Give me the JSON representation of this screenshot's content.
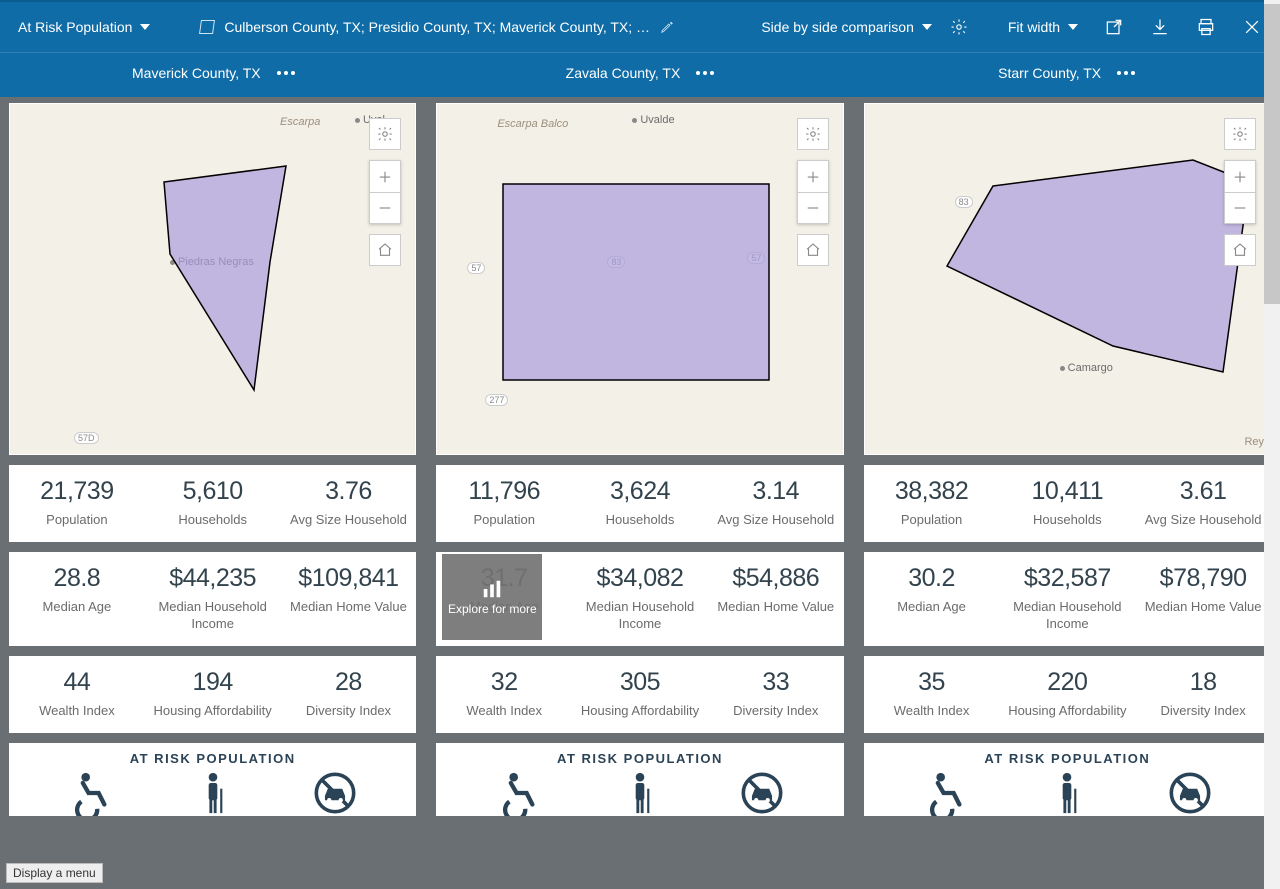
{
  "topbar": {
    "template_name": "At Risk Population",
    "geo_text": "Culberson County, TX; Presidio County, TX; Maverick County, TX; …",
    "view_mode": "Side by side comparison",
    "fit": "Fit width"
  },
  "columns": [
    {
      "title": "Maverick County, TX",
      "map_city": "Piedras Negras",
      "map_road": "57D",
      "map_label": "Escarpa",
      "map_label2": "Uval",
      "stats1": [
        {
          "v": "21,739",
          "l": "Population"
        },
        {
          "v": "5,610",
          "l": "Households"
        },
        {
          "v": "3.76",
          "l": "Avg Size Household"
        }
      ],
      "stats2": [
        {
          "v": "28.8",
          "l": "Median Age"
        },
        {
          "v": "$44,235",
          "l": "Median Household Income"
        },
        {
          "v": "$109,841",
          "l": "Median Home Value"
        }
      ],
      "stats3": [
        {
          "v": "44",
          "l": "Wealth Index"
        },
        {
          "v": "194",
          "l": "Housing Affordability"
        },
        {
          "v": "28",
          "l": "Diversity Index"
        }
      ],
      "section_title": "AT RISK POPULATION"
    },
    {
      "title": "Zavala County, TX",
      "map_label": "Escarpa Balco",
      "map_label2": "Uvalde",
      "map_road": "57",
      "map_road2": "83",
      "map_road3": "277",
      "map_road4": "57",
      "stats1": [
        {
          "v": "11,796",
          "l": "Population"
        },
        {
          "v": "3,624",
          "l": "Households"
        },
        {
          "v": "3.14",
          "l": "Avg Size Household"
        }
      ],
      "stats2": [
        {
          "v": "31.7",
          "l": "Median Age"
        },
        {
          "v": "$34,082",
          "l": "Median Household Income"
        },
        {
          "v": "$54,886",
          "l": "Median Home Value"
        }
      ],
      "stats3": [
        {
          "v": "32",
          "l": "Wealth Index"
        },
        {
          "v": "305",
          "l": "Housing Affordability"
        },
        {
          "v": "33",
          "l": "Diversity Index"
        }
      ],
      "section_title": "AT RISK POPULATION",
      "explore": "Explore for more"
    },
    {
      "title": "Starr County, TX",
      "map_city": "Camargo",
      "map_road": "83",
      "map_label2": "Rey",
      "stats1": [
        {
          "v": "38,382",
          "l": "Population"
        },
        {
          "v": "10,411",
          "l": "Households"
        },
        {
          "v": "3.61",
          "l": "Avg Size Household"
        }
      ],
      "stats2": [
        {
          "v": "30.2",
          "l": "Median Age"
        },
        {
          "v": "$32,587",
          "l": "Median Household Income"
        },
        {
          "v": "$78,790",
          "l": "Median Home Value"
        }
      ],
      "stats3": [
        {
          "v": "35",
          "l": "Wealth Index"
        },
        {
          "v": "220",
          "l": "Housing Affordability"
        },
        {
          "v": "18",
          "l": "Diversity Index"
        }
      ],
      "section_title": "AT RISK POPULATION"
    }
  ],
  "status": "Display a menu"
}
